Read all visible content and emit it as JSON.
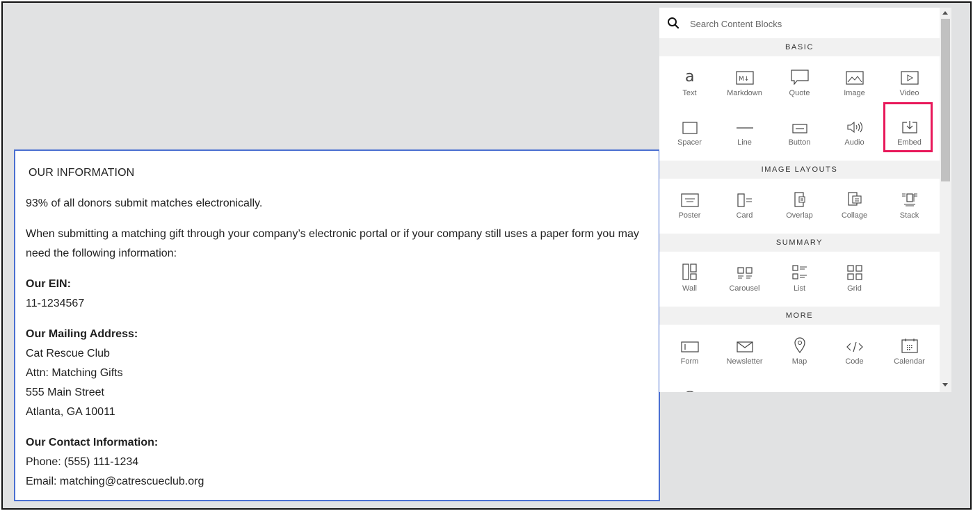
{
  "info": {
    "heading": "OUR INFORMATION",
    "intro": "93% of all donors submit matches electronically.",
    "paragraph": "When submitting a matching gift through your company’s electronic portal or if your company still uses a paper form you may need the following information:",
    "ein_label": "Our EIN:",
    "ein_value": "11-1234567",
    "mailing_label": "Our Mailing Address:",
    "mailing_lines": [
      "Cat Rescue Club",
      "Attn: Matching Gifts",
      "555 Main Street",
      "Atlanta, GA 10011"
    ],
    "contact_label": "Our Contact Information:",
    "phone": "Phone: (555) 111-1234",
    "email": "Email: matching@catrescueclub.org"
  },
  "panel": {
    "search_placeholder": "Search Content Blocks",
    "sections": [
      {
        "title": "BASIC",
        "items": [
          "Text",
          "Markdown",
          "Quote",
          "Image",
          "Video",
          "Spacer",
          "Line",
          "Button",
          "Audio",
          "Embed"
        ]
      },
      {
        "title": "IMAGE LAYOUTS",
        "items": [
          "Poster",
          "Card",
          "Overlap",
          "Collage",
          "Stack"
        ]
      },
      {
        "title": "SUMMARY",
        "items": [
          "Wall",
          "Carousel",
          "List",
          "Grid"
        ]
      },
      {
        "title": "MORE",
        "items": [
          "Form",
          "Newsletter",
          "Map",
          "Code",
          "Calendar"
        ]
      }
    ],
    "selected_item": "Embed",
    "accent_color": "#e8185a"
  }
}
